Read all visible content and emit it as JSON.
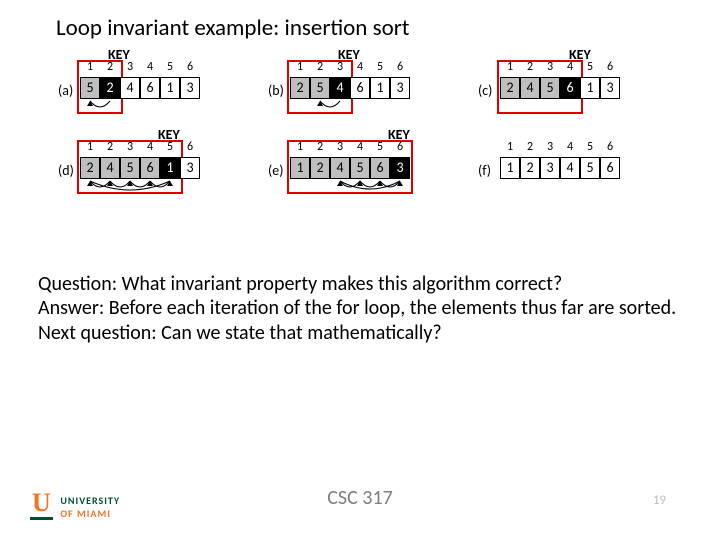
{
  "title": "Loop invariant example: insertion sort",
  "keyLabel": "KEY",
  "panels": {
    "a": {
      "label": "(a)",
      "indices": [
        "1",
        "2",
        "3",
        "4",
        "5",
        "6"
      ],
      "cells": [
        {
          "v": "5",
          "s": "g"
        },
        {
          "v": "2",
          "s": "b"
        },
        {
          "v": "4",
          "s": ""
        },
        {
          "v": "6",
          "s": ""
        },
        {
          "v": "1",
          "s": ""
        },
        {
          "v": "3",
          "s": ""
        }
      ],
      "key": 1,
      "red": 2,
      "arrows": [
        [
          1,
          0
        ]
      ]
    },
    "b": {
      "label": "(b)",
      "indices": [
        "1",
        "2",
        "3",
        "4",
        "5",
        "6"
      ],
      "cells": [
        {
          "v": "2",
          "s": "g"
        },
        {
          "v": "5",
          "s": "g"
        },
        {
          "v": "4",
          "s": "b"
        },
        {
          "v": "6",
          "s": ""
        },
        {
          "v": "1",
          "s": ""
        },
        {
          "v": "3",
          "s": ""
        }
      ],
      "key": 2,
      "red": 3,
      "arrows": [
        [
          2,
          1
        ]
      ]
    },
    "c": {
      "label": "(c)",
      "indices": [
        "1",
        "2",
        "3",
        "4",
        "5",
        "6"
      ],
      "cells": [
        {
          "v": "2",
          "s": "g"
        },
        {
          "v": "4",
          "s": "g"
        },
        {
          "v": "5",
          "s": "g"
        },
        {
          "v": "6",
          "s": "b"
        },
        {
          "v": "1",
          "s": ""
        },
        {
          "v": "3",
          "s": ""
        }
      ],
      "key": 3,
      "red": 4,
      "arrows": []
    },
    "d": {
      "label": "(d)",
      "indices": [
        "1",
        "2",
        "3",
        "4",
        "5",
        "6"
      ],
      "cells": [
        {
          "v": "2",
          "s": "g"
        },
        {
          "v": "4",
          "s": "g"
        },
        {
          "v": "5",
          "s": "g"
        },
        {
          "v": "6",
          "s": "g"
        },
        {
          "v": "1",
          "s": "b"
        },
        {
          "v": "3",
          "s": ""
        }
      ],
      "key": 4,
      "red": 5,
      "arrows": [
        [
          4,
          0
        ],
        [
          3,
          4
        ],
        [
          2,
          3
        ],
        [
          1,
          2
        ],
        [
          0,
          1
        ]
      ]
    },
    "e": {
      "label": "(e)",
      "indices": [
        "1",
        "2",
        "3",
        "4",
        "5",
        "6"
      ],
      "cells": [
        {
          "v": "1",
          "s": "g"
        },
        {
          "v": "2",
          "s": "g"
        },
        {
          "v": "4",
          "s": "g"
        },
        {
          "v": "5",
          "s": "g"
        },
        {
          "v": "6",
          "s": "g"
        },
        {
          "v": "3",
          "s": "b"
        }
      ],
      "key": 5,
      "red": 6,
      "arrows": [
        [
          5,
          2
        ],
        [
          4,
          5
        ],
        [
          3,
          4
        ],
        [
          2,
          3
        ]
      ]
    },
    "f": {
      "label": "(f)",
      "indices": [
        "1",
        "2",
        "3",
        "4",
        "5",
        "6"
      ],
      "cells": [
        {
          "v": "1",
          "s": ""
        },
        {
          "v": "2",
          "s": ""
        },
        {
          "v": "3",
          "s": ""
        },
        {
          "v": "4",
          "s": ""
        },
        {
          "v": "5",
          "s": ""
        },
        {
          "v": "6",
          "s": ""
        }
      ],
      "key": null,
      "red": 0,
      "arrows": []
    }
  },
  "question": "Question: What invariant property makes this algorithm correct?",
  "answer": "Answer: Before each iteration of the for loop, the elements thus far are sorted.",
  "next": "Next question: Can we state that mathematically?",
  "course": "CSC 317",
  "pagenum": "19",
  "logo": {
    "univ": "UNIVERSITY",
    "of": "OF MIAMI"
  },
  "chart_data": {
    "type": "table",
    "description": "Six snapshots (a–f) of insertion sort on array [5,2,4,6,1,3]; indices 1..6; black cell = current key; gray = sorted prefix; arrows show shifts",
    "states": [
      {
        "step": "a",
        "array": [
          5,
          2,
          4,
          6,
          1,
          3
        ],
        "sorted_prefix_len": 1,
        "key_index": 2
      },
      {
        "step": "b",
        "array": [
          2,
          5,
          4,
          6,
          1,
          3
        ],
        "sorted_prefix_len": 2,
        "key_index": 3
      },
      {
        "step": "c",
        "array": [
          2,
          4,
          5,
          6,
          1,
          3
        ],
        "sorted_prefix_len": 3,
        "key_index": 4
      },
      {
        "step": "d",
        "array": [
          2,
          4,
          5,
          6,
          1,
          3
        ],
        "sorted_prefix_len": 4,
        "key_index": 5
      },
      {
        "step": "e",
        "array": [
          1,
          2,
          4,
          5,
          6,
          3
        ],
        "sorted_prefix_len": 5,
        "key_index": 6
      },
      {
        "step": "f",
        "array": [
          1,
          2,
          3,
          4,
          5,
          6
        ],
        "sorted_prefix_len": 6,
        "key_index": null
      }
    ]
  }
}
